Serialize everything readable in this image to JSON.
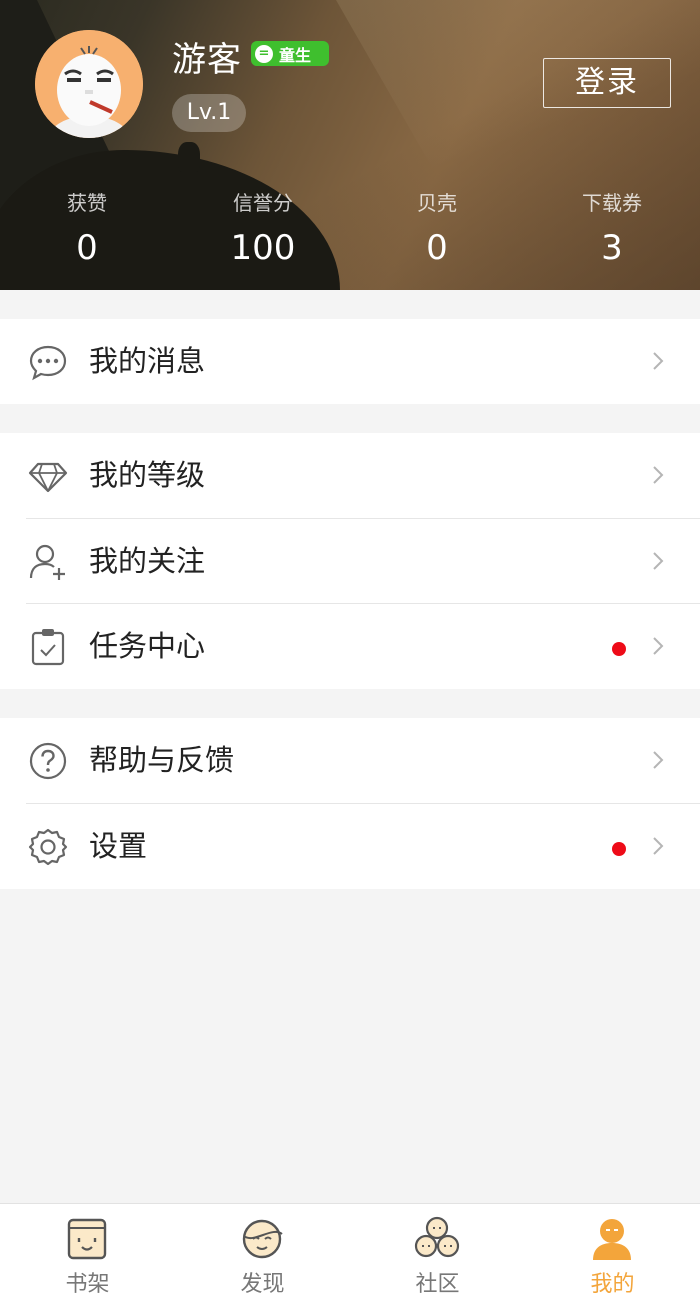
{
  "profile": {
    "name": "游客",
    "badge": "童生",
    "badge_icon": "=",
    "level": "Lv.1",
    "login_label": "登录"
  },
  "stats": [
    {
      "label": "获赞",
      "value": "0"
    },
    {
      "label": "信誉分",
      "value": "100"
    },
    {
      "label": "贝壳",
      "value": "0"
    },
    {
      "label": "下载券",
      "value": "3"
    }
  ],
  "menu": {
    "messages": {
      "label": "我的消息",
      "icon": "chat-bubble-icon"
    },
    "level": {
      "label": "我的等级",
      "icon": "diamond-icon"
    },
    "follow": {
      "label": "我的关注",
      "icon": "add-user-icon"
    },
    "tasks": {
      "label": "任务中心",
      "icon": "clipboard-icon",
      "has_notification": true
    },
    "help": {
      "label": "帮助与反馈",
      "icon": "question-icon"
    },
    "settings": {
      "label": "设置",
      "icon": "gear-icon",
      "has_notification": true
    }
  },
  "tabs": [
    {
      "label": "书架",
      "icon": "bookshelf-icon",
      "active": false
    },
    {
      "label": "发现",
      "icon": "discover-icon",
      "active": false
    },
    {
      "label": "社区",
      "icon": "community-icon",
      "active": false
    },
    {
      "label": "我的",
      "icon": "me-icon",
      "active": true
    }
  ],
  "colors": {
    "accent": "#f3a53b",
    "notification": "#ee0b18",
    "badge": "#3fbf2e"
  }
}
